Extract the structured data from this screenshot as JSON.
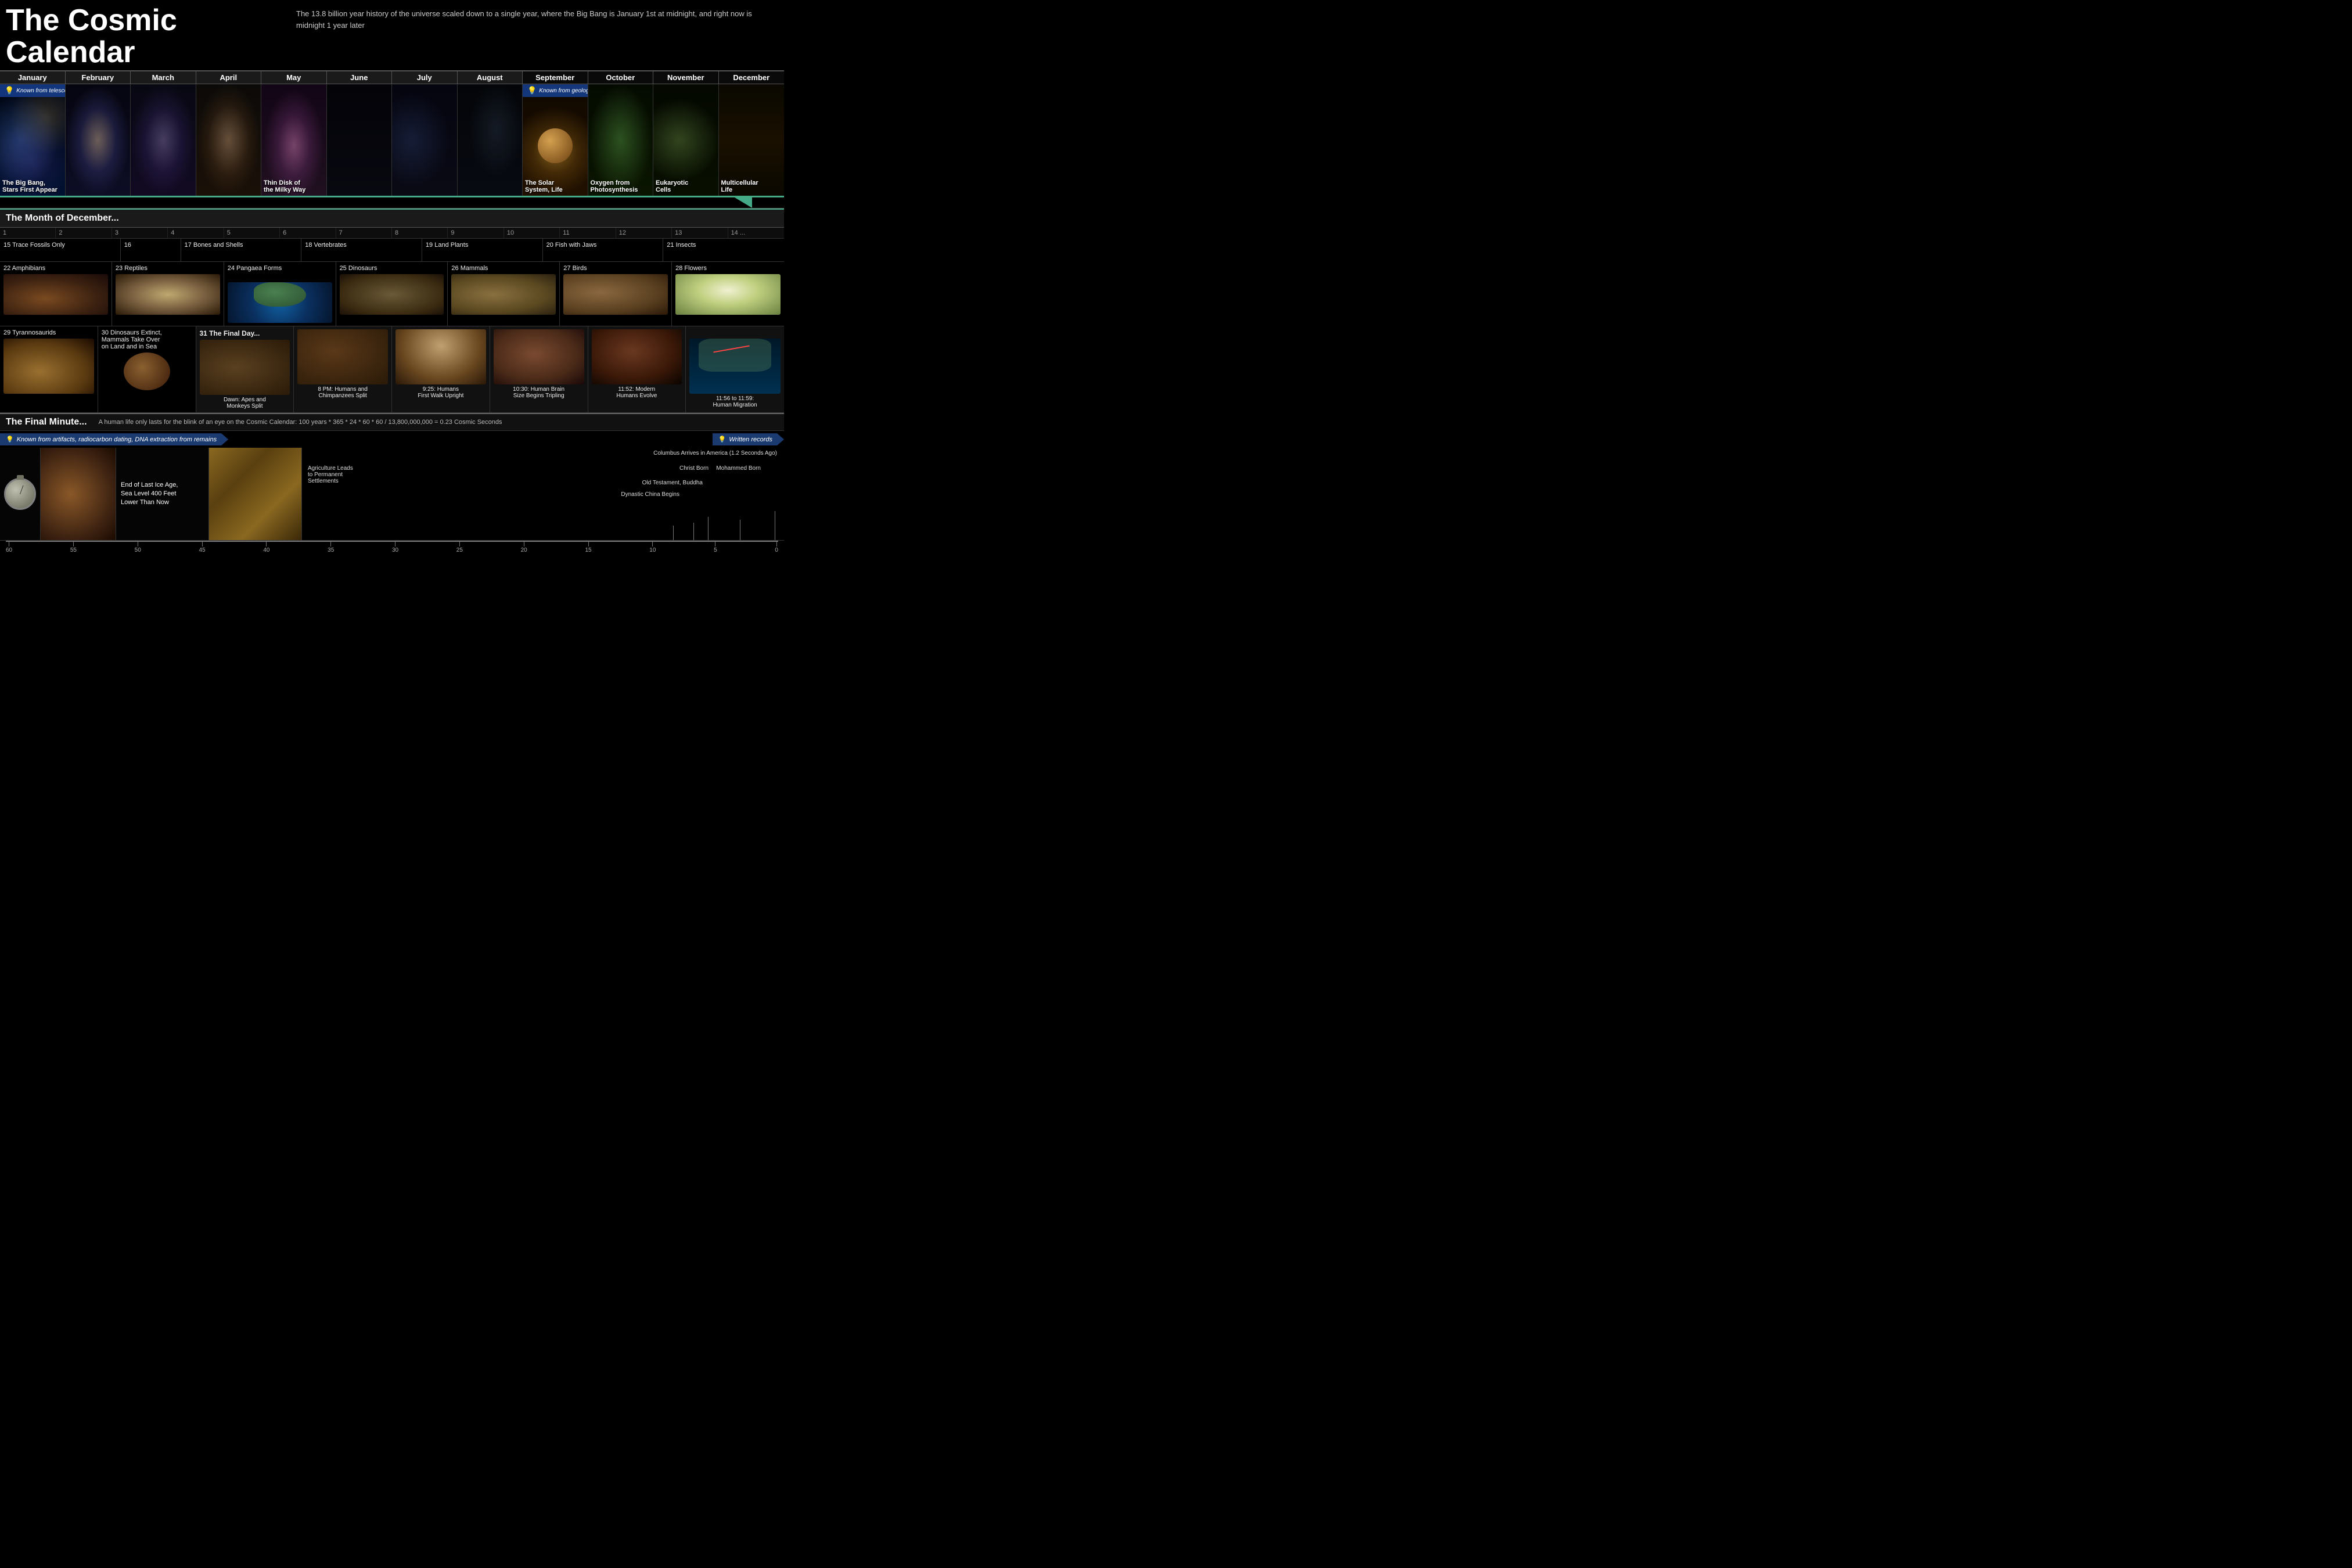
{
  "title": "The Cosmic Calendar",
  "subtitle": "The 13.8 billion year history of the universe scaled down to a single year, where the Big Bang is January 1st at midnight, and right now is midnight 1 year later",
  "months": [
    "January",
    "February",
    "March",
    "April",
    "May",
    "June",
    "July",
    "August",
    "September",
    "October",
    "November",
    "December"
  ],
  "top_events": [
    {
      "label": "The Big Bang,\nStars First Appear",
      "col": 1
    },
    {
      "label": "Thin Disk of\nthe Milky Way",
      "col": 5
    },
    {
      "label": "The Solar\nSystem, Life",
      "col": 9
    },
    {
      "label": "Oxygen from\nPhotosynthesis",
      "col": 10
    },
    {
      "label": "Eukaryotic\nCells",
      "col": 11
    },
    {
      "label": "Multicellular\nLife",
      "col": 12
    }
  ],
  "banner_telescope": "Known from telescopes looking back in time, physical models",
  "banner_geologic": "Known from geologic record, fossils, genetic drift",
  "banner_artifact": "Known from artifacts, radiocarbon dating, DNA extraction from remains",
  "banner_written": "Written records",
  "december_header": "The Month of December...",
  "dec_days": [
    "1",
    "2",
    "3",
    "4",
    "5",
    "6",
    "7",
    "8",
    "9",
    "10",
    "11",
    "12",
    "13",
    "14",
    "..."
  ],
  "dec_row1": [
    {
      "label": "15 Trace Fossils Only",
      "span": 2
    },
    {
      "label": "16"
    },
    {
      "label": "17 Bones and Shells",
      "span": 2
    },
    {
      "label": "18 Vertebrates",
      "span": 2
    },
    {
      "label": "19 Land Plants",
      "span": 2
    },
    {
      "label": "20 Fish with Jaws",
      "span": 2
    },
    {
      "label": "21 Insects",
      "span": 2
    }
  ],
  "dec_row2": [
    {
      "label": "22 Amphibians"
    },
    {
      "label": "23 Reptiles"
    },
    {
      "label": "24 Pangaea Forms"
    },
    {
      "label": "25 Dinosaurs"
    },
    {
      "label": "26 Mammals"
    },
    {
      "label": "27 Birds"
    },
    {
      "label": "28 Flowers"
    }
  ],
  "dec_row3": [
    {
      "label": "29 Tyrannosaurids"
    },
    {
      "label": "30 Dinosaurs Extinct,\nMammals Take Over\non Land and in Sea"
    },
    {
      "label": "31 The Final Day..."
    },
    {
      "label": "Dawn: Apes and\nMonkeys Split"
    },
    {
      "label": "8 PM: Humans and\nChimpanzees Split"
    },
    {
      "label": "9:25: Humans\nFirst Walk Upright"
    },
    {
      "label": "10:30: Human Brain\nSize Begins Tripling"
    },
    {
      "label": "11:52: Modern\nHumans Evolve"
    },
    {
      "label": "11:56 to 11:59:\nHuman Migration"
    }
  ],
  "final_minute_header": "The Final Minute...",
  "final_minute_sub": "A human life only lasts for the blink of an eye on the Cosmic Calendar: 100 years * 365 * 24 * 60 * 60  /  13,800,000,000  =  0.23 Cosmic Seconds",
  "final_events": [
    {
      "label": "End of Last Ice Age,\nSea Level 400 Feet\nLower Than Now",
      "pos": 50
    },
    {
      "label": "Agriculture Leads\nto Permanent\nSettlements",
      "pos": 25
    },
    {
      "label": "Dynastic China Begins",
      "pos": 15
    },
    {
      "label": "Old Testament, Buddha",
      "pos": 12
    },
    {
      "label": "Christ Born",
      "pos": 10
    },
    {
      "label": "Mohammed Born",
      "pos": 8
    },
    {
      "label": "Columbus Arrives in America (1.2 Seconds Ago)",
      "pos": 5
    }
  ],
  "timeline_ticks": [
    "60",
    "55",
    "50",
    "45",
    "40",
    "35",
    "30",
    "25",
    "20",
    "15",
    "10",
    "5",
    "0"
  ]
}
